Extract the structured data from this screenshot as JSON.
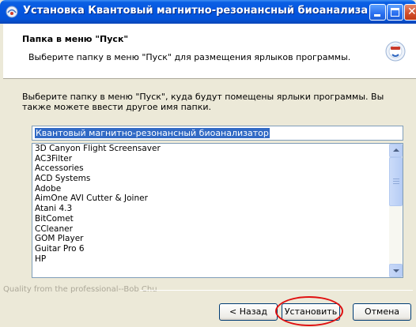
{
  "window": {
    "title": "Установка Квантовый магнитно-резонансный биоанализатор..."
  },
  "header": {
    "title": "Папка в меню \"Пуск\"",
    "subtitle": "Выберите папку в меню \"Пуск\" для размещения ярлыков программы."
  },
  "body": {
    "instruction": "Выберите папку в меню \"Пуск\", куда будут помещены ярлыки программы. Вы также можете ввести другое имя папки.",
    "folder_value": "Квантовый магнитно-резонансный биоанализатор",
    "folders": [
      "3D Canyon Flight Screensaver",
      "AC3Filter",
      "Accessories",
      "ACD Systems",
      "Adobe",
      "AimOne AVI Cutter & Joiner",
      "Atani 4.3",
      "BitComet",
      "CCleaner",
      "GOM Player",
      "Guitar Pro 6",
      "HP"
    ]
  },
  "footer": {
    "branding": "Quality from the professional--Bob Chu",
    "back_label": "< Назад",
    "install_label": "Установить",
    "cancel_label": "Отмена"
  },
  "colors": {
    "titlebar": "#0556df",
    "selection": "#316ac5",
    "highlight": "#e01010"
  }
}
